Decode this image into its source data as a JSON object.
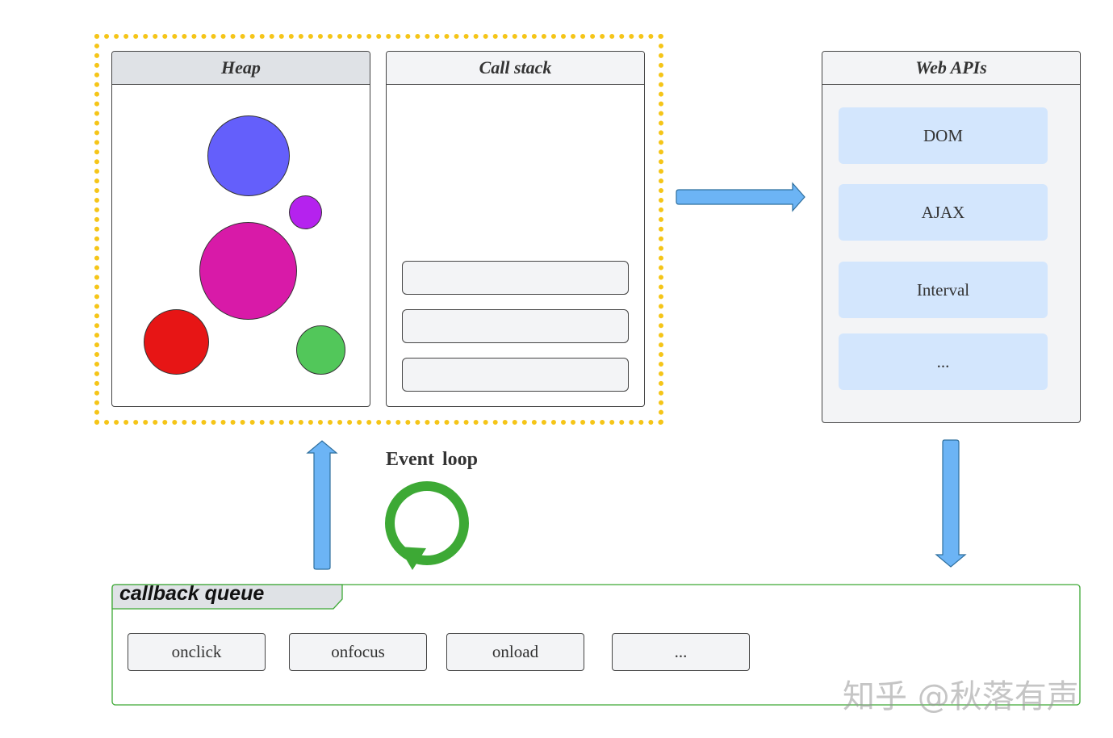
{
  "heap": {
    "title": "Heap"
  },
  "call_stack": {
    "title": "Call stack"
  },
  "web_apis": {
    "title": "Web APIs",
    "items": [
      "DOM",
      "AJAX",
      "Interval",
      "..."
    ]
  },
  "event_loop": {
    "label": "Event  loop"
  },
  "callback_queue": {
    "title": "callback queue",
    "items": [
      "onclick",
      "onfocus",
      "onload",
      "..."
    ]
  },
  "watermark": "知乎 @秋落有声",
  "colors": {
    "dotted_border": "#f5c518",
    "arrow_fill": "#6cb4f5",
    "loop_green": "#3da935",
    "api_item_bg": "#d3e6fd",
    "circles": [
      "#645ffb",
      "#b522ee",
      "#d81aa8",
      "#e71515",
      "#52c75a"
    ]
  }
}
